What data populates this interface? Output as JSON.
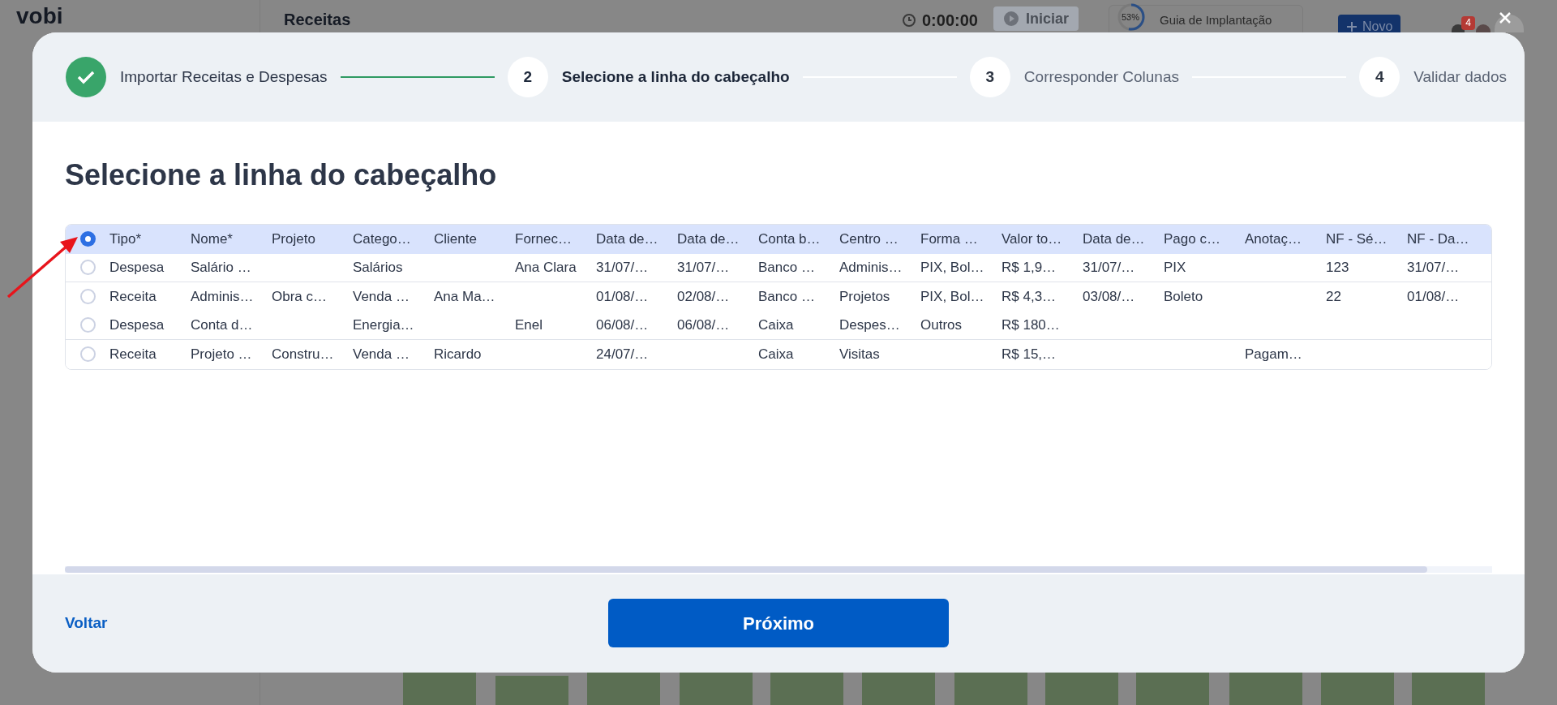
{
  "background_app": {
    "logo": "vobi",
    "page_title": "Receitas",
    "timer": "0:00:00",
    "start_button": "Iniciar",
    "guide": {
      "percent": "53%",
      "level": 0.53,
      "title": "Guia de Implantação"
    },
    "new_button": "Novo",
    "notifications_badge": "4"
  },
  "stepper": [
    {
      "label": "Importar Receitas e Despesas",
      "done": true,
      "selected": false
    },
    {
      "number": "2",
      "label": "Selecione a linha do cabeçalho",
      "done": false,
      "selected": true
    },
    {
      "number": "3",
      "label": "Corresponder Colunas",
      "done": false,
      "selected": false
    },
    {
      "number": "4",
      "label": "Validar dados",
      "done": false,
      "selected": false
    }
  ],
  "title": "Selecione a linha do cabeçalho",
  "table": {
    "rows": [
      {
        "selected": true,
        "cells": [
          "Tipo*",
          "Nome*",
          "Projeto",
          "Catego…",
          "Cliente",
          "Fornec…",
          "Data de…",
          "Data de…",
          "Conta b…",
          "Centro …",
          "Forma …",
          "Valor to…",
          "Data de…",
          "Pago c…",
          "Anotaç…",
          "NF - Sé…",
          "NF - Da…"
        ]
      },
      {
        "selected": false,
        "cells": [
          "Despesa",
          "Salário …",
          "",
          "Salários",
          "",
          "Ana Clara",
          "31/07/…",
          "31/07/…",
          "Banco …",
          "Adminis…",
          "PIX, Bol…",
          "R$ 1,9…",
          "31/07/…",
          "PIX",
          "",
          "123",
          "31/07/…"
        ]
      },
      {
        "selected": false,
        "cells": [
          "Receita",
          "Adminis…",
          "Obra c…",
          "Venda …",
          "Ana Ma…",
          "",
          "01/08/…",
          "02/08/…",
          "Banco …",
          "Projetos",
          "PIX, Bol…",
          "R$ 4,3…",
          "03/08/…",
          "Boleto",
          "",
          "22",
          "01/08/…"
        ]
      },
      {
        "selected": false,
        "cells": [
          "Despesa",
          "Conta d…",
          "",
          "Energia…",
          "",
          "Enel",
          "06/08/…",
          "06/08/…",
          "Caixa",
          "Despes…",
          "Outros",
          "R$ 180…",
          "",
          "",
          "",
          "",
          ""
        ]
      },
      {
        "selected": false,
        "cells": [
          "Receita",
          "Projeto …",
          "Constru…",
          "Venda …",
          "Ricardo",
          "",
          "24/07/…",
          "",
          "Caixa",
          "Visitas",
          "",
          "R$ 15,…",
          "",
          "",
          "Pagam…",
          "",
          ""
        ]
      }
    ]
  },
  "footer": {
    "back_link": "Voltar",
    "next_button": "Próximo"
  }
}
